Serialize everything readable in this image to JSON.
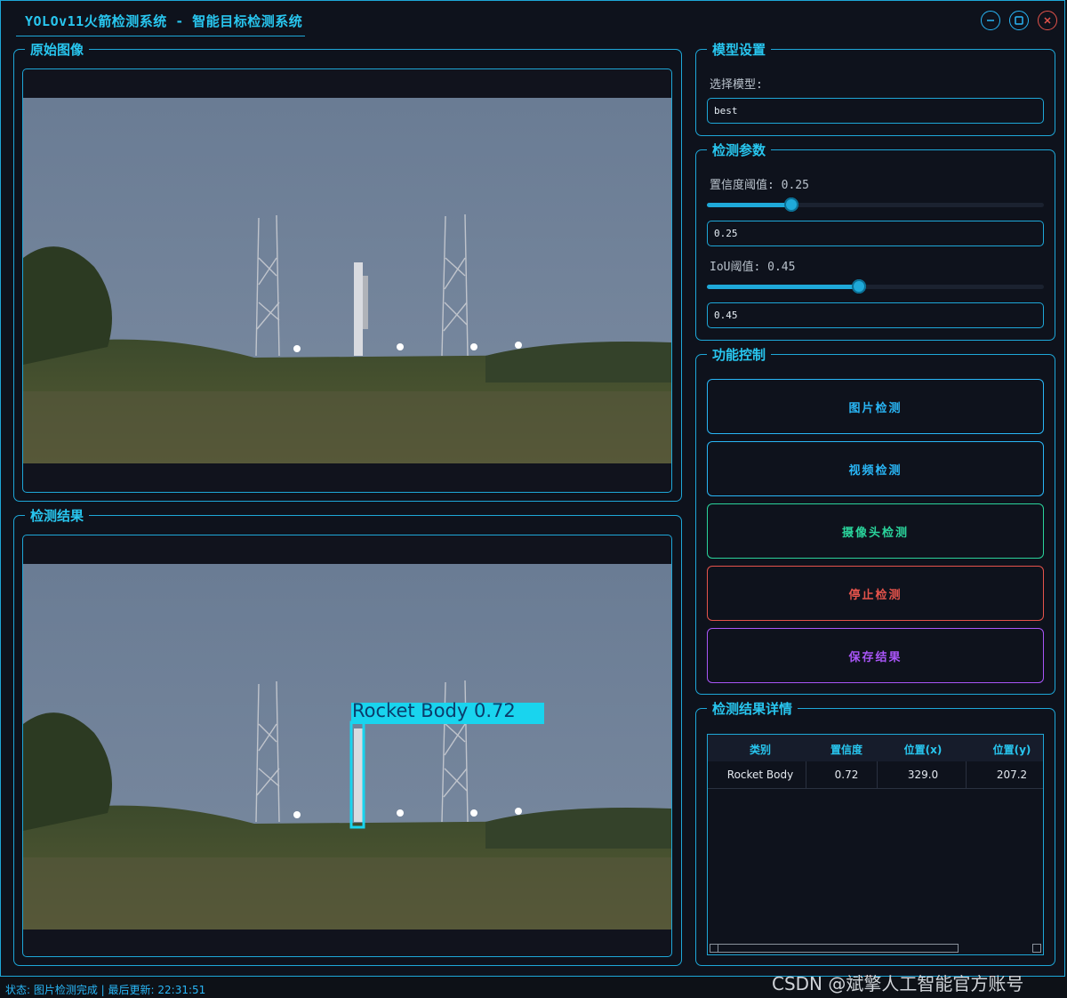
{
  "window": {
    "title": "YOLOv11火箭检测系统 - 智能目标检测系统",
    "accent_color": "#1ea7d8",
    "icons": [
      "minimize-icon",
      "maximize-icon",
      "close-icon"
    ]
  },
  "panels": {
    "original_title": "原始图像",
    "result_title": "检测结果"
  },
  "detection_overlay": {
    "label": "Rocket Body 0.72",
    "color": "#19d4ee"
  },
  "model_settings": {
    "title": "模型设置",
    "select_label": "选择模型:",
    "selected_model": "best"
  },
  "params": {
    "title": "检测参数",
    "confidence_label": "置信度阈值: 0.25",
    "confidence_value": "0.25",
    "confidence_level": 0.25,
    "iou_label": "IoU阈值: 0.45",
    "iou_value": "0.45",
    "iou_level": 0.45
  },
  "controls": {
    "title": "功能控制",
    "buttons": [
      {
        "label": "图片检测",
        "color": "#29b6f6"
      },
      {
        "label": "视频检测",
        "color": "#29b6f6"
      },
      {
        "label": "摄像头检测",
        "color": "#2ad39b"
      },
      {
        "label": "停止检测",
        "color": "#e5534b"
      },
      {
        "label": "保存结果",
        "color": "#a855f7"
      }
    ]
  },
  "results": {
    "title": "检测结果详情",
    "columns": [
      "类别",
      "置信度",
      "位置(x)",
      "位置(y)"
    ],
    "rows": [
      [
        "Rocket Body",
        "0.72",
        "329.0",
        "207.2"
      ]
    ]
  },
  "status": {
    "text": "状态: 图片检测完成 | 最后更新: 22:31:51"
  },
  "watermark": "CSDN @斌擎人工智能官方账号"
}
